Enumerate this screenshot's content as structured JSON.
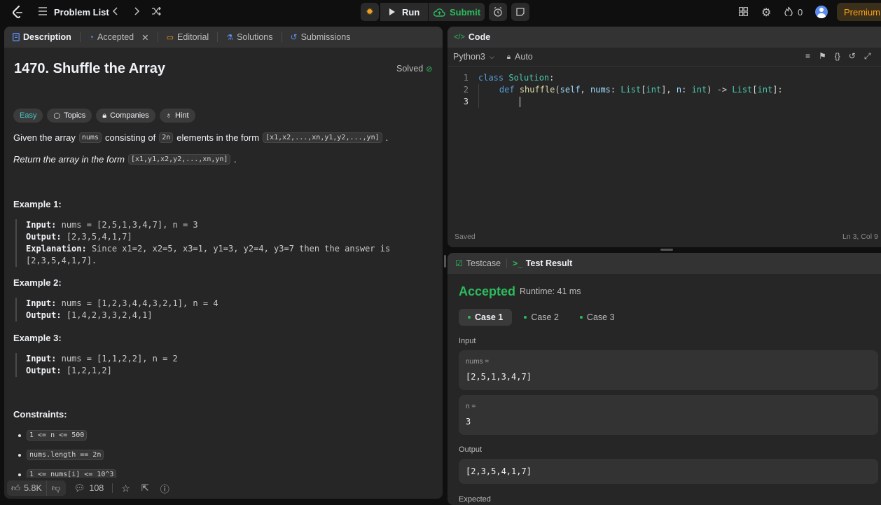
{
  "topbar": {
    "problem_list": "Problem List",
    "run": "Run",
    "submit": "Submit",
    "streak_count": "0",
    "premium": "Premium"
  },
  "left_tabs": {
    "description": "Description",
    "accepted": "Accepted",
    "editorial": "Editorial",
    "solutions": "Solutions",
    "submissions": "Submissions"
  },
  "problem": {
    "title": "1470. Shuffle the Array",
    "solved": "Solved",
    "difficulty": "Easy",
    "topics": "Topics",
    "companies": "Companies",
    "hint": "Hint",
    "desc1_pre": "Given the array",
    "desc1_code1": "nums",
    "desc1_mid": "consisting of",
    "desc1_code2": "2n",
    "desc1_post": "elements in the form",
    "desc1_form": "[x1,x2,...,xn,y1,y2,...,yn]",
    "desc2": "Return the array in the form",
    "desc2_form": "[x1,y1,x2,y2,...,xn,yn]",
    "ex1_title": "Example 1:",
    "ex1_input": "nums = [2,5,1,3,4,7], n = 3",
    "ex1_output": "[2,3,5,4,1,7]",
    "ex1_expl": "Since x1=2, x2=5, x3=1, y1=3, y2=4, y3=7 then the answer is",
    "ex1_expl2": "[2,3,5,4,1,7].",
    "ex2_title": "Example 2:",
    "ex2_input": "nums = [1,2,3,4,4,3,2,1], n = 4",
    "ex2_output": "[1,4,2,3,3,2,4,1]",
    "ex3_title": "Example 3:",
    "ex3_input": "nums = [1,1,2,2], n = 2",
    "ex3_output": "[1,2,1,2]",
    "input_label": "Input:",
    "output_label": "Output:",
    "expl_label": "Explanation:",
    "constraints_title": "Constraints:",
    "constraints": [
      "1 <= n <= 500",
      "nums.length == 2n",
      "1 <= nums[i] <= 10^3"
    ]
  },
  "footer": {
    "likes": "5.8K",
    "comments": "108"
  },
  "code": {
    "tab": "Code",
    "language": "Python3",
    "auto": "Auto",
    "line_numbers": [
      "1",
      "2",
      "3"
    ],
    "saved": "Saved",
    "cursor": "Ln 3, Col 9"
  },
  "result": {
    "testcase_tab": "Testcase",
    "result_tab": "Test Result",
    "status": "Accepted",
    "runtime": "Runtime: 41 ms",
    "cases": [
      "Case 1",
      "Case 2",
      "Case 3"
    ],
    "input_label": "Input",
    "var1_name": "nums =",
    "var1_value": "[2,5,1,3,4,7]",
    "var2_name": "n =",
    "var2_value": "3",
    "output_label": "Output",
    "output_value": "[2,3,5,4,1,7]",
    "expected_label": "Expected"
  },
  "colors": {
    "accent_green": "#2cbb5d",
    "easy": "#46c6c2",
    "premium": "#ffa116"
  }
}
